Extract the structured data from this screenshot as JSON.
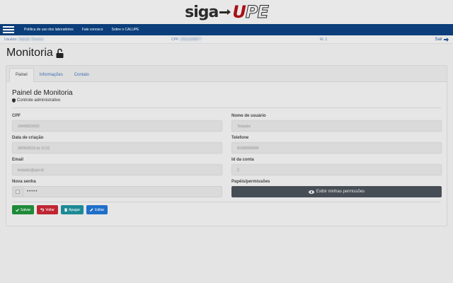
{
  "logo": {
    "siga": "siga",
    "upe_u": "U",
    "upe_pe": "PE"
  },
  "nav": {
    "links": [
      "Política de uso dos laboratórios",
      "Fale conosco",
      "Sobre o CALUPE"
    ]
  },
  "userbar": {
    "user_label": "Usuário:",
    "user_value": "Valmão Teixeira",
    "cpf_label": "CPF:",
    "cpf_value": "23511005877",
    "ie_label": "IE:",
    "ie_value": "1",
    "logout_label": "Sair"
  },
  "page": {
    "title": "Monitoria"
  },
  "tabs": [
    "Painel",
    "Informações",
    "Contato"
  ],
  "panel": {
    "title": "Painel de Monitoria",
    "subtitle": "Controle administrativo"
  },
  "fields": {
    "cpf": {
      "label": "CPF",
      "value": "24495823420"
    },
    "username": {
      "label": "Nome de usuário",
      "value": "Testador"
    },
    "created": {
      "label": "Data de criação",
      "value": "28/06/2019 às 11:52"
    },
    "phone": {
      "label": "Telefone",
      "value": "81999999999"
    },
    "email": {
      "label": "Email",
      "value": "testador@upe.br"
    },
    "account_id": {
      "label": "Id da conta",
      "value": "2"
    },
    "password": {
      "label": "Nova senha",
      "value": "•••••"
    },
    "roles": {
      "label": "Papéis/permissões",
      "button": "Exibir minhas permissões"
    }
  },
  "actions": {
    "save": "Salvar",
    "back": "Voltar",
    "delete": "Apagar",
    "edit": "Editar"
  }
}
